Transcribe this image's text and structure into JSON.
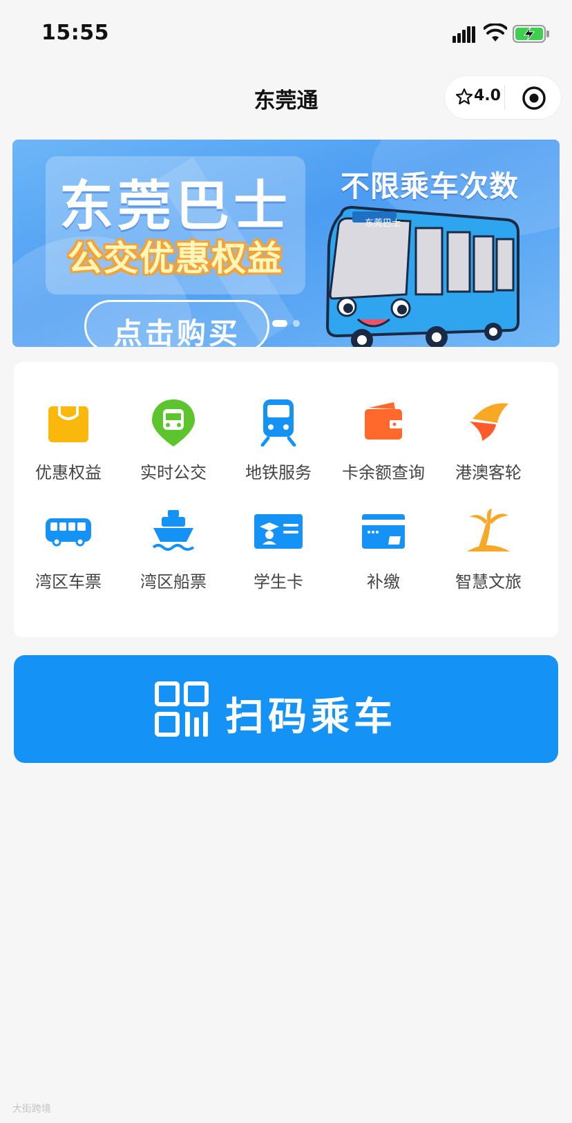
{
  "status_bar": {
    "time": "15:55"
  },
  "nav": {
    "title": "东莞通",
    "rating": "4.0"
  },
  "banner": {
    "title": "东莞巴士",
    "subtitle": "公交优惠权益",
    "button_label": "点击购买",
    "slogan": "不限乘车次数",
    "bus_sign": "东莞巴士",
    "slide_count": 2,
    "active_slide": 1
  },
  "services": [
    {
      "label": "优惠权益",
      "icon": "shopping-bag-icon"
    },
    {
      "label": "实时公交",
      "icon": "bus-location-pin-icon"
    },
    {
      "label": "地铁服务",
      "icon": "metro-train-icon"
    },
    {
      "label": "卡余额查询",
      "icon": "wallet-icon"
    },
    {
      "label": "港澳客轮",
      "icon": "ferry-sail-icon"
    },
    {
      "label": "湾区车票",
      "icon": "coach-bus-icon"
    },
    {
      "label": "湾区船票",
      "icon": "ship-icon"
    },
    {
      "label": "学生卡",
      "icon": "student-card-icon"
    },
    {
      "label": "补缴",
      "icon": "payment-card-icon"
    },
    {
      "label": "智慧文旅",
      "icon": "palm-tree-icon"
    }
  ],
  "scan": {
    "label": "扫码乘车",
    "icon": "qr-code-icon"
  },
  "watermark": "大街跨境",
  "colors": {
    "primary": "#1592f6",
    "orange": "#f9a825",
    "green": "#5cc52d",
    "coral": "#ff6a2c"
  }
}
